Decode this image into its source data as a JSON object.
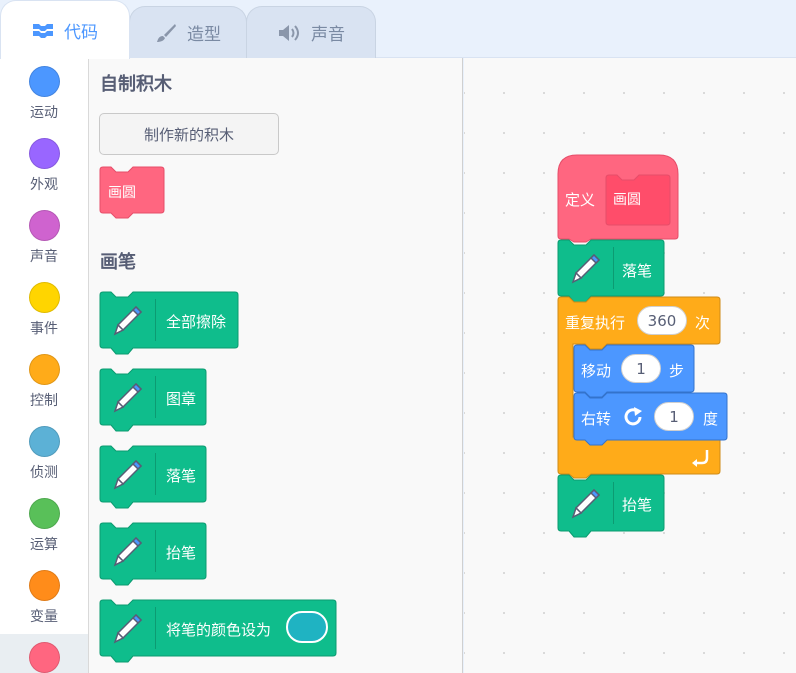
{
  "tabs": [
    {
      "label": "代码",
      "icon": "code-icon",
      "active": true
    },
    {
      "label": "造型",
      "icon": "brush-icon",
      "active": false
    },
    {
      "label": "声音",
      "icon": "speaker-icon",
      "active": false
    }
  ],
  "categories": [
    {
      "label": "运动",
      "color": "#4c97ff"
    },
    {
      "label": "外观",
      "color": "#9966ff"
    },
    {
      "label": "声音",
      "color": "#cf63cf"
    },
    {
      "label": "事件",
      "color": "#ffd500"
    },
    {
      "label": "控制",
      "color": "#ffab19"
    },
    {
      "label": "侦测",
      "color": "#5cb1d6"
    },
    {
      "label": "运算",
      "color": "#59c059"
    },
    {
      "label": "变量",
      "color": "#ff8c1a"
    },
    {
      "label": "",
      "color": "#ff6680"
    }
  ],
  "palette": {
    "my_blocks_title": "自制积木",
    "make_block_button": "制作新的积木",
    "custom_block_label": "画圆",
    "pen_title": "画笔",
    "pen_blocks": [
      "全部擦除",
      "图章",
      "落笔",
      "抬笔",
      "将笔的颜色设为"
    ],
    "pen_color_value": "#1fb3c2"
  },
  "script": {
    "define_label": "定义",
    "define_name": "画圆",
    "pen_down_label": "落笔",
    "repeat_label": "重复执行",
    "repeat_count": "360",
    "repeat_suffix": "次",
    "move_label": "移动",
    "move_steps": "1",
    "move_suffix": "步",
    "turn_label": "右转",
    "turn_degrees": "1",
    "turn_suffix": "度",
    "pen_up_label": "抬笔"
  },
  "colors": {
    "pen": "#0fbd8c",
    "pen_border": "#0b9a70",
    "my_blocks": "#ff6680",
    "my_blocks_border": "#e64d69",
    "control": "#ffab19",
    "control_border": "#cf8b17",
    "motion": "#4c97ff",
    "motion_border": "#3373cc"
  }
}
